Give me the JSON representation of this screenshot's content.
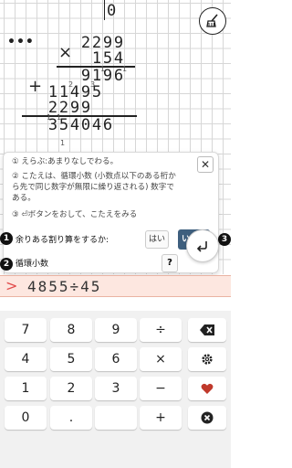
{
  "work": {
    "quotient_digit": "0",
    "multiply_sign": "×",
    "multiplicand": [
      "2",
      "2",
      "9",
      "9"
    ],
    "multiplier": [
      "1",
      "5",
      "4"
    ],
    "partial1": [
      "9",
      "1",
      "9",
      "6"
    ],
    "plus_sign": "+",
    "partial2": [
      "1",
      "1",
      "4",
      "9",
      "5"
    ],
    "partial3": [
      "2",
      "2",
      "9",
      "9"
    ],
    "result": [
      "3",
      "5",
      "4",
      "0",
      "4",
      "6"
    ],
    "carries_row1": [
      "1",
      "1"
    ],
    "carries_row2": [
      "2",
      "3"
    ],
    "carries_result": [
      "1",
      "1"
    ],
    "carry_below": "1"
  },
  "toolbar": {
    "menu_glyph": "•••"
  },
  "popup": {
    "line1": "① えらぶ:あまりなしでわる。",
    "line2a": "② こたえは、循環小数 (小数点以下のある桁か",
    "line2b": "ら先で同じ数字が無限に繰り返される) 数字で",
    "line2c": "ある。",
    "line3": "③ ⏎ボタンをおして、こたえをみる",
    "close_label": "✕",
    "badge1": "1",
    "question": "余りある割り算をするか:",
    "yes_label": "はい",
    "no_label": "いいえ",
    "badge2": "2",
    "answer_label": "循環小数",
    "help_label": "?",
    "badge3": "3"
  },
  "input": {
    "prompt": ">",
    "expression": "4855÷45"
  },
  "keypad": {
    "keys": [
      [
        "7",
        "8",
        "9",
        "÷",
        "backspace-icon"
      ],
      [
        "4",
        "5",
        "6",
        "×",
        "gear-icon"
      ],
      [
        "1",
        "2",
        "3",
        "−",
        "heart-icon"
      ],
      [
        "0",
        ".",
        "",
        "+",
        "close-circle-icon"
      ]
    ],
    "accent": "#c0392b"
  },
  "colors": {
    "primary_button": "#3e5f7e",
    "prompt": "#e24b4b",
    "input_bg": "#fde7e0"
  }
}
